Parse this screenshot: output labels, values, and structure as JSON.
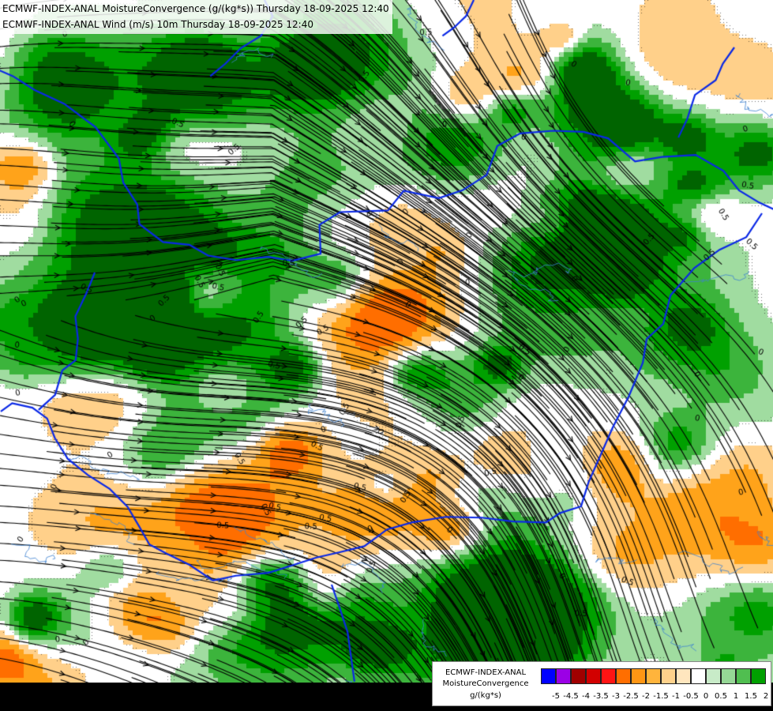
{
  "header": {
    "line1": "ECMWF-INDEX-ANAL MoistureConvergence (g/(kg*s)) Thursday 18-09-2025 12:40",
    "line2": "ECMWF-INDEX-ANAL Wind (m/s) 10m Thursday 18-09-2025 12:40"
  },
  "map": {
    "contour_labels": [
      "0",
      "0.5"
    ],
    "colors": {
      "border": "#0a28e6",
      "river": "#3c82d2",
      "streamline": "#000000",
      "green_dark": "#00a000",
      "green_mid": "#3cb43c",
      "green_light": "#a0dca0",
      "orange": "#ffa31a",
      "orange_light": "#ffd08a"
    }
  },
  "legend": {
    "title_line1": "ECMWF-INDEX-ANAL",
    "title_line2": "MoistureConvergence",
    "title_line3": "g/(kg*s)",
    "ticks": [
      "-5",
      "-4.5",
      "-4",
      "-3.5",
      "-3",
      "-2.5",
      "-2",
      "-1.5",
      "-1",
      "-0.5",
      "0",
      "0.5",
      "1",
      "1.5",
      "2"
    ],
    "swatches": [
      "#0000ff",
      "#9b00e6",
      "#a00000",
      "#d20000",
      "#ff1414",
      "#ff6e00",
      "#ff9614",
      "#ffb43c",
      "#ffd28c",
      "#ffe6be",
      "#ffffff",
      "#c8ebc8",
      "#96d796",
      "#50be50",
      "#00a000"
    ]
  }
}
